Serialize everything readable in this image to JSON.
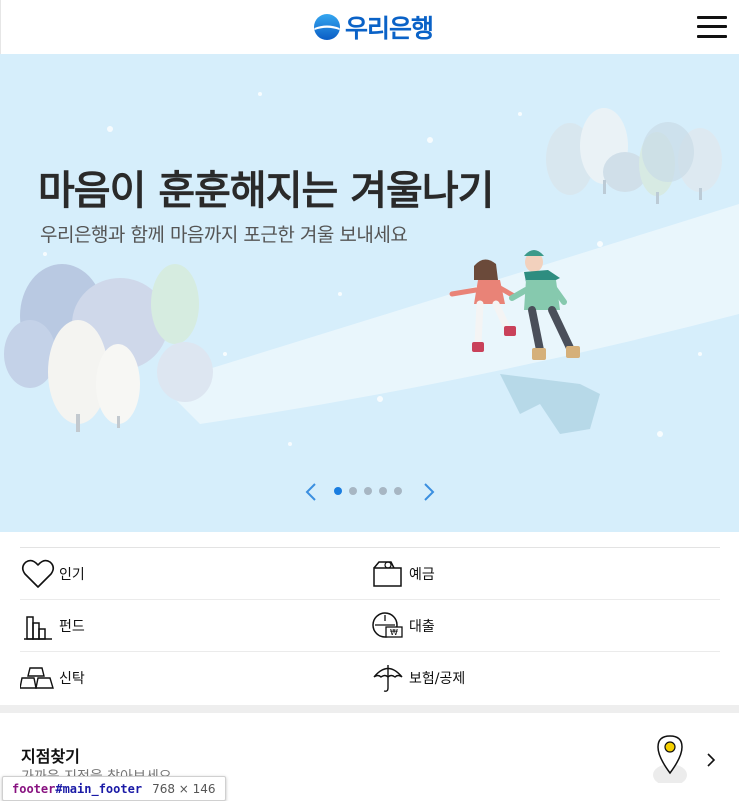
{
  "header": {
    "logo_text": "우리은행",
    "logo_icon": "woori-bank-logo-icon",
    "menu_icon": "hamburger-menu-icon",
    "brand_color": "#0a62c7"
  },
  "banner": {
    "title": "마음이 훈훈해지는 겨울나기",
    "subtitle": "우리은행과 함께 마음까지 포근한 겨울 보내세요",
    "background_color": "#d6eefb",
    "slides_total": 5,
    "active_slide": 1,
    "prev_icon": "chevron-left-icon",
    "next_icon": "chevron-right-icon"
  },
  "categories": [
    {
      "label": "인기",
      "icon": "heart-icon"
    },
    {
      "label": "예금",
      "icon": "wallet-icon"
    },
    {
      "label": "펀드",
      "icon": "bar-chart-icon"
    },
    {
      "label": "대출",
      "icon": "loan-coin-icon"
    },
    {
      "label": "신탁",
      "icon": "gold-bars-icon"
    },
    {
      "label": "보험/공제",
      "icon": "umbrella-icon"
    }
  ],
  "branch_finder": {
    "title": "지점찾기",
    "description": "가까운 지점을 찾아보세요",
    "icon": "location-pin-icon",
    "arrow_icon": "chevron-right-icon"
  },
  "devtools_tooltip": {
    "tag": "footer",
    "id": "#main_footer",
    "dimensions": "768 × 146"
  }
}
